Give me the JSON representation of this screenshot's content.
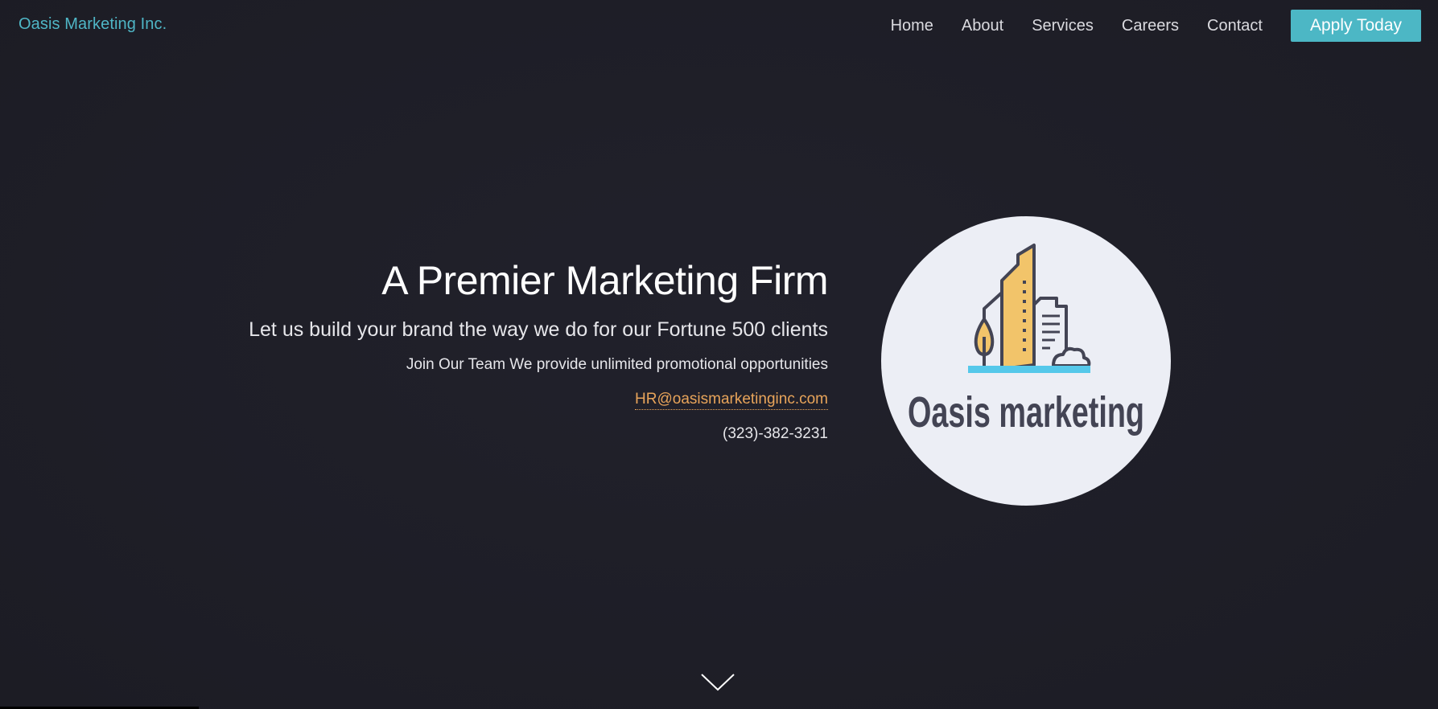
{
  "header": {
    "brand": "Oasis Marketing Inc.",
    "nav": [
      "Home",
      "About",
      "Services",
      "Careers",
      "Contact"
    ],
    "cta_label": "Apply Today"
  },
  "hero": {
    "title": "A Premier Marketing Firm",
    "subtitle": "Let us build your brand the way we do for our Fortune 500 clients",
    "tagline": "Join Our Team We provide unlimited promotional opportunities",
    "email": "HR@oasismarketinginc.com",
    "phone": "(323)-382-3231"
  },
  "logo": {
    "wordmark": "Oasis marketing",
    "icon": "city-buildings-tree-icon"
  },
  "icons": {
    "scroll": "chevron-down-icon"
  },
  "colors": {
    "background": "#1f1f28",
    "accent": "#4cb7c5",
    "link": "#e8a45a",
    "logo_bg": "#eceef5",
    "logo_building": "#f2c46a",
    "logo_ground": "#55c8ea",
    "logo_outline": "#434454"
  }
}
